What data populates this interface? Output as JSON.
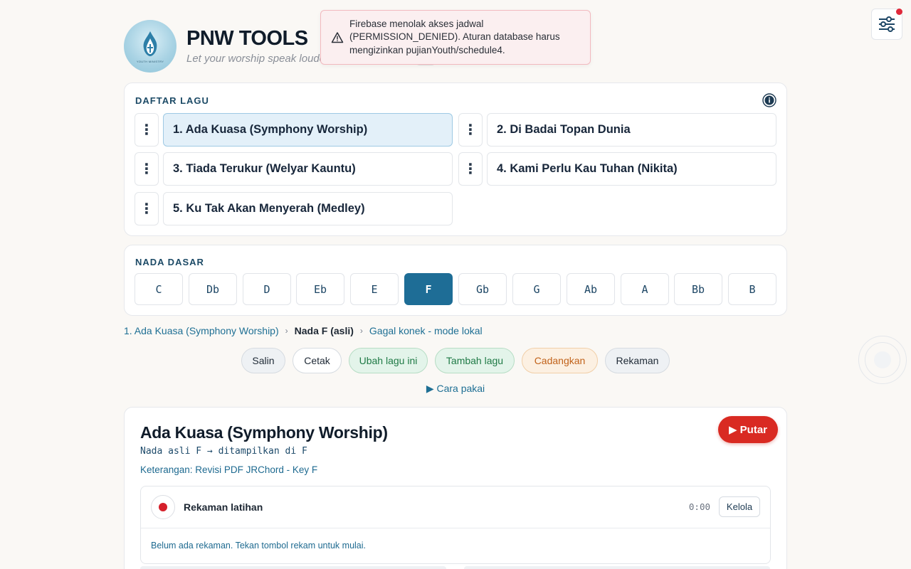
{
  "header": {
    "title": "PNW TOOLS",
    "tagline": "Let your worship speak louder",
    "logo_text": "YOUTH MINISTRY"
  },
  "toast": {
    "message": "Firebase menolak akses jadwal (PERMISSION_DENIED). Aturan database harus mengizinkan pujianYouth/schedule4."
  },
  "song_list": {
    "label": "DAFTAR LAGU",
    "songs": [
      "1. Ada Kuasa (Symphony Worship)",
      "2. Di Badai Topan Dunia",
      "3. Tiada Terukur (Welyar Kauntu)",
      "4. Kami Perlu Kau Tuhan (Nikita)",
      "5. Ku Tak Akan Menyerah (Medley)"
    ],
    "active_index": 0,
    "kebab_glyph": "⋮"
  },
  "key_panel": {
    "label": "NADA DASAR",
    "keys": [
      "C",
      "Db",
      "D",
      "Eb",
      "E",
      "F",
      "Gb",
      "G",
      "Ab",
      "A",
      "Bb",
      "B"
    ],
    "active_key": "F"
  },
  "breadcrumb": {
    "song": "1. Ada Kuasa (Symphony Worship)",
    "key": "Nada F (asli)",
    "status": "Gagal konek - mode lokal",
    "separator": "›"
  },
  "actions": {
    "copy": "Salin",
    "print": "Cetak",
    "edit": "Ubah lagu ini",
    "add": "Tambah lagu",
    "backup": "Cadangkan",
    "recordings": "Rekaman"
  },
  "howto": "▶ Cara pakai",
  "detail": {
    "title": "Ada Kuasa (Symphony Worship)",
    "key_info": "Nada asli F → ditampilkan di F",
    "description": "Keterangan: Revisi PDF JRChord - Key F",
    "play_label": "▶ Putar",
    "recording": {
      "label": "Rekaman latihan",
      "time": "0:00",
      "manage": "Kelola",
      "empty": "Belum ada rekaman. Tekan tombol rekam untuk mulai."
    }
  },
  "colors": {
    "accent": "#1e6d96",
    "danger": "#d92a22",
    "toast_bg": "#fbeff0",
    "green": "#1f7a46",
    "orange": "#c1621a"
  },
  "icons": {
    "toast": "warning-triangle-icon",
    "settings": "sliders-icon",
    "info": "info-icon",
    "record": "record-dot-icon"
  }
}
